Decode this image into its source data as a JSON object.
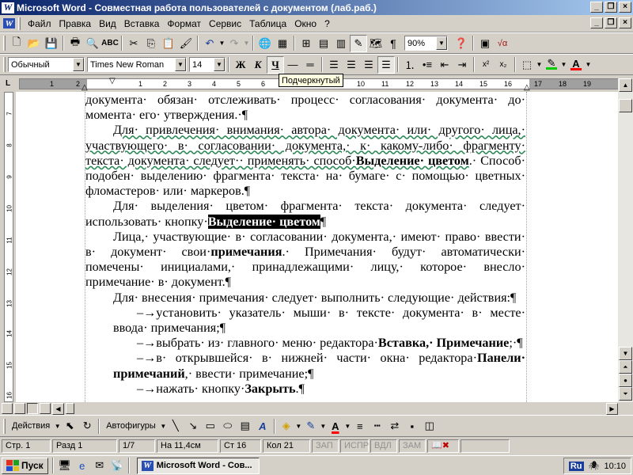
{
  "window": {
    "title": "Microsoft Word - Совместная работа пользователей с документом (лаб.раб.)",
    "app_icon": "W"
  },
  "menu": {
    "items": [
      "Файл",
      "Правка",
      "Вид",
      "Вставка",
      "Формат",
      "Сервис",
      "Таблица",
      "Окно",
      "?"
    ]
  },
  "standard_toolbar": {
    "zoom": "90%"
  },
  "format_toolbar": {
    "style": "Обычный",
    "font": "Times New Roman",
    "size": "14",
    "bold": "Ж",
    "italic": "К",
    "underline": "Ч",
    "sup": "x²",
    "sub": "x₂",
    "font_color_letter": "A",
    "highlight_color": "#00cc00",
    "font_color": "#ff0000"
  },
  "tooltip": "Подчеркнутый",
  "ruler": {
    "numbers": [
      "1",
      "2",
      "1",
      "2",
      "3",
      "4",
      "5",
      "6",
      "7",
      "8",
      "9",
      "10",
      "11",
      "12",
      "13",
      "14",
      "15",
      "16",
      "17",
      "18",
      "19"
    ]
  },
  "vertical_ruler": {
    "numbers": [
      "7",
      "8",
      "9",
      "10",
      "11",
      "12",
      "13",
      "14",
      "15",
      "16"
    ]
  },
  "document": {
    "p1": "документа· обязан· отслеживать· процесс· согласования· документа· до· момента· его· утверждения.·¶",
    "p2a": "Для· привлечения· внимания· автора· документа· или· другого· лица,· участвующего· в· согласовании· документа,· к· какому-либо· фрагменту· текста· документа· следует·· применять· способ·",
    "p2b": "Выделение· цветом",
    "p2c": ".· Способ· подобен· выделению· фрагмента· текста· на· бумаге· с· помощью· цветных· фломастеров· или· маркеров.¶",
    "p3a": "Для· выделения· цветом· фрагмента· текста· документа· следует· использовать· кнопку·",
    "p3b": "Выделение· цветом",
    "p3c": "¶",
    "p4a": "Лица,· участвующие· в· согласовании· документа,· имеют· право· ввести· в· документ· свои·",
    "p4b": "примечания",
    "p4c": ".· Примечания· будут· автоматически· помечены· инициалами,· принадлежащими· лицу,· которое· внесло· примечание· в· документ.¶",
    "p5": "Для· внесения· примечания· следует· выполнить· следующие· действия:¶",
    "b1": "–→установить· указатель· мыши· в· тексте· документа· в· месте· ввода· примечания;¶",
    "b2a": "–→выбрать· из· главного· меню· редактора·",
    "b2b": "Вставка,· Примечание",
    "b2c": ";·¶",
    "b3a": "–→в· открывшейся· в· нижней· части· окна· редактора·",
    "b3b": "Панели· примечаний",
    "b3c": ",· ввести· примечание;¶",
    "b4a": "–→нажать· кнопку·",
    "b4b": "Закрыть",
    "b4c": ".¶"
  },
  "drawing_toolbar": {
    "actions": "Действия",
    "autoshapes": "Автофигуры"
  },
  "status": {
    "page": "Стр. 1",
    "section": "Разд 1",
    "pages": "1/7",
    "at": "На 11,4см",
    "line": "Ст 16",
    "col": "Кол 21",
    "rec": "ЗАП",
    "trk": "ИСПР",
    "ext": "ВДЛ",
    "ovr": "ЗАМ"
  },
  "taskbar": {
    "start": "Пуск",
    "task": "Microsoft Word - Сов...",
    "lang": "Ru",
    "clock": "10:10"
  }
}
